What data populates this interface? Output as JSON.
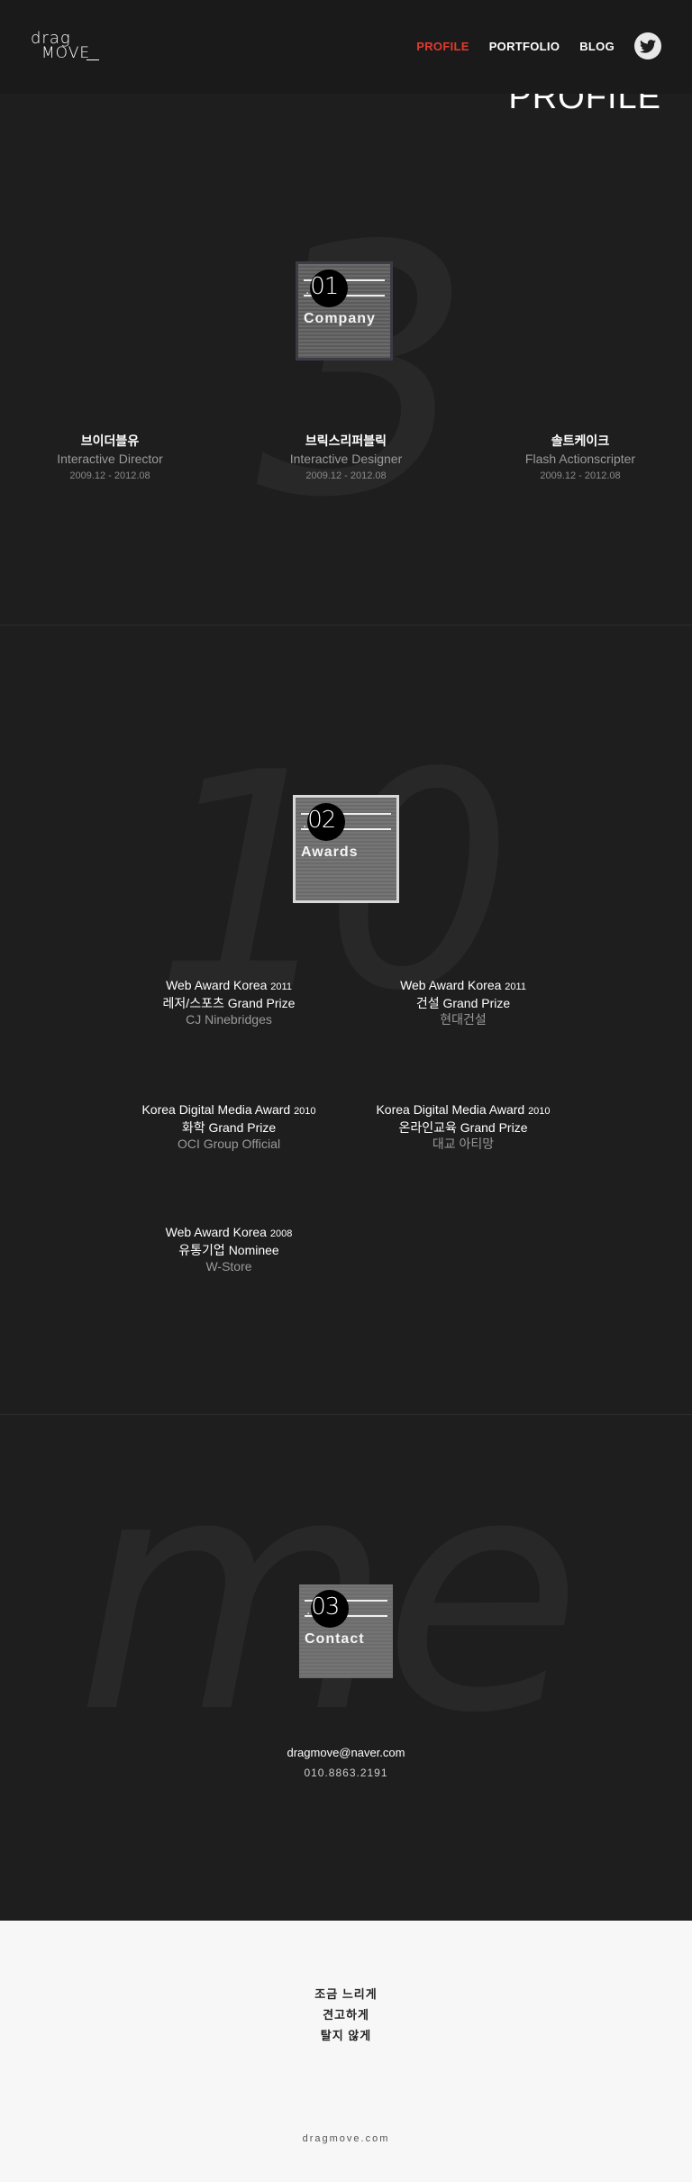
{
  "header": {
    "logo_line1": "drag",
    "logo_line2": "MOVE",
    "nav": [
      {
        "label": "PROFILE",
        "active": true
      },
      {
        "label": "PORTFOLIO",
        "active": false
      },
      {
        "label": "BLOG",
        "active": false
      }
    ],
    "social_icon": "twitter-icon"
  },
  "page_title": "PROFILE",
  "sections": {
    "company": {
      "bg_number": "3",
      "badge_number": ".01",
      "badge_label": "Company",
      "items": [
        {
          "name": "브이더블유",
          "role": "Interactive Director",
          "period": "2009.12 - 2012.08"
        },
        {
          "name": "브릭스리퍼블릭",
          "role": "Interactive Designer",
          "period": "2009.12 - 2012.08"
        },
        {
          "name": "솔트케이크",
          "role": "Flash Actionscripter",
          "period": "2009.12 - 2012.08"
        }
      ]
    },
    "awards": {
      "bg_number": "10",
      "badge_number": ".02",
      "badge_label": "Awards",
      "items": [
        {
          "title": "Web Award Korea",
          "year": "2011",
          "prize": "레저/스포츠 Grand Prize",
          "client": "CJ Ninebridges"
        },
        {
          "title": "Web Award Korea",
          "year": "2011",
          "prize": "건설 Grand Prize",
          "client": "현대건설"
        },
        {
          "title": "Korea Digital Media Award",
          "year": "2010",
          "prize": "화학 Grand Prize",
          "client": "OCI Group Official"
        },
        {
          "title": "Korea Digital Media Award",
          "year": "2010",
          "prize": "온라인교육 Grand Prize",
          "client": "대교 아티망"
        },
        {
          "title": "Web Award Korea",
          "year": "2008",
          "prize": "유통기업 Nominee",
          "client": "W-Store"
        }
      ]
    },
    "contact": {
      "bg_text": "me",
      "badge_number": ".03",
      "badge_label": "Contact",
      "email": "dragmove@naver.com",
      "phone": "010.8863.2191"
    }
  },
  "footer": {
    "motto": [
      "조금 느리게",
      "견고하게",
      "탈지 않게"
    ],
    "site": "dragmove.com"
  },
  "colors": {
    "background": "#1e1e1e",
    "accent": "#e03a2e",
    "footer_bg": "#f7f7f7"
  }
}
